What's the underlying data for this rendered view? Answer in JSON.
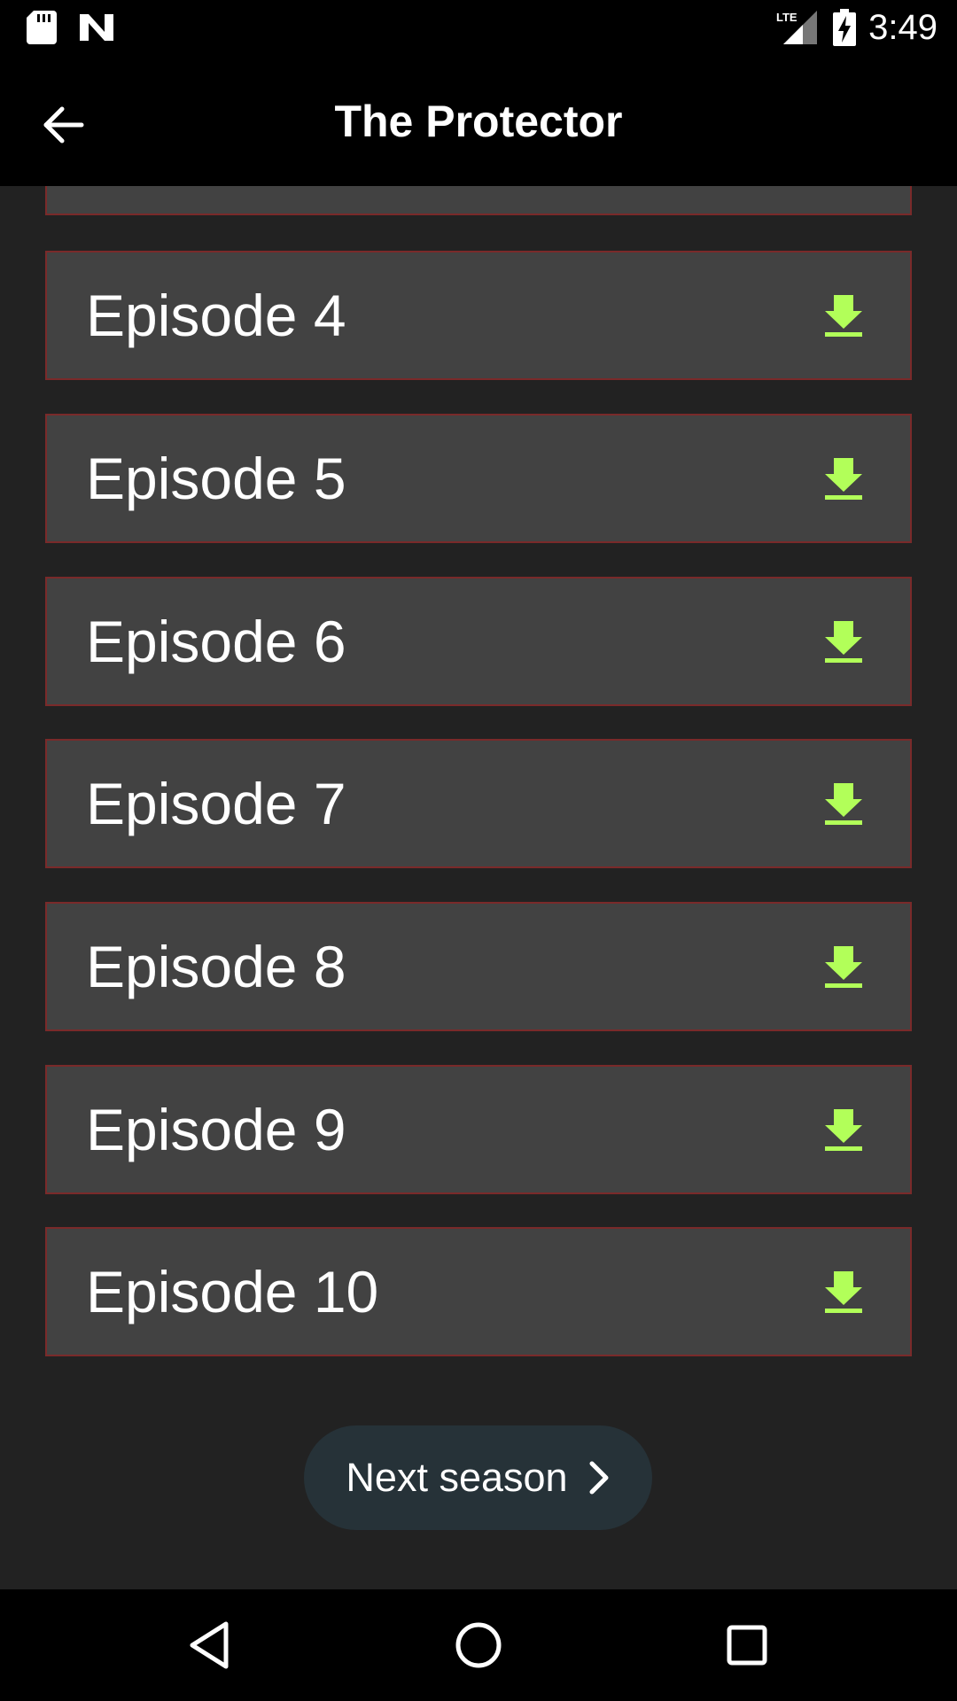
{
  "status_bar": {
    "time": "3:49",
    "network": "LTE",
    "icons": [
      "sd-card-icon",
      "n-logo-icon",
      "lte-signal-icon",
      "battery-charging-icon"
    ]
  },
  "app_bar": {
    "title": "The Protector",
    "back_icon": "arrow-left-icon"
  },
  "episodes": [
    {
      "label": "Episode 4",
      "icon": "download-icon"
    },
    {
      "label": "Episode 5",
      "icon": "download-icon"
    },
    {
      "label": "Episode 6",
      "icon": "download-icon"
    },
    {
      "label": "Episode 7",
      "icon": "download-icon"
    },
    {
      "label": "Episode 8",
      "icon": "download-icon"
    },
    {
      "label": "Episode 9",
      "icon": "download-icon"
    },
    {
      "label": "Episode 10",
      "icon": "download-icon"
    }
  ],
  "next_season": {
    "label": "Next season",
    "icon": "chevron-right-icon"
  },
  "nav_bar": {
    "icons": [
      "back-triangle-icon",
      "home-circle-icon",
      "recents-square-icon"
    ]
  },
  "colors": {
    "background": "#222222",
    "card": "#424242",
    "card_border": "#7a2a2a",
    "accent_download": "#b2ff59",
    "button": "#263238"
  }
}
